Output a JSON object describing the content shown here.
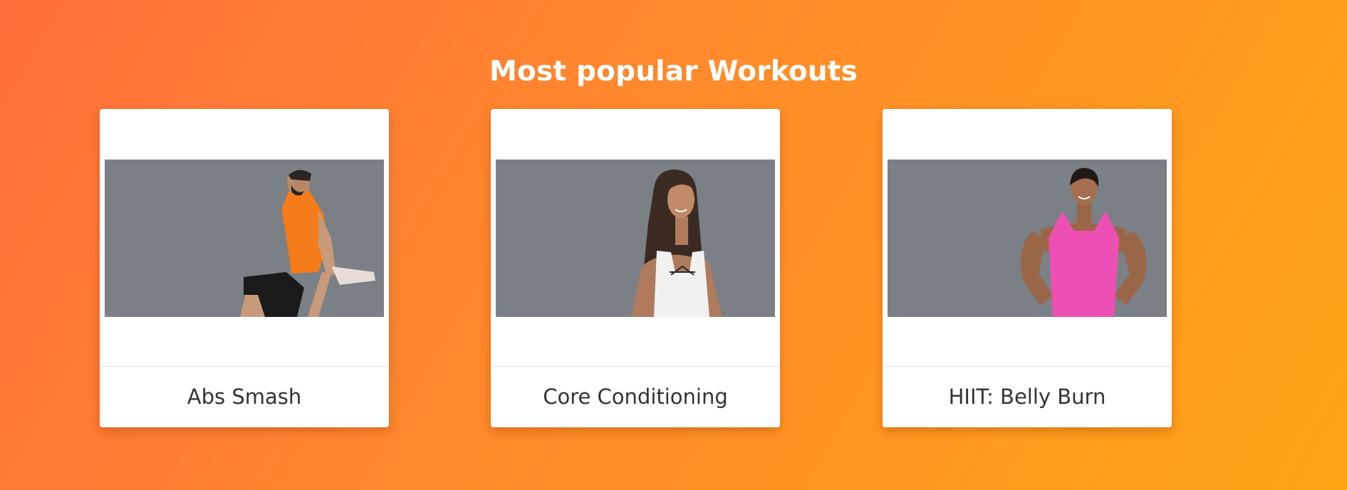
{
  "section": {
    "title": "Most popular Workouts"
  },
  "workouts": [
    {
      "label": "Abs Smash",
      "image": "man-stretching-quad-photo"
    },
    {
      "label": "Core Conditioning",
      "image": "woman-white-top-photo"
    },
    {
      "label": "HIIT: Belly Burn",
      "image": "woman-pink-top-photo"
    }
  ],
  "colors": {
    "background_start": "#ff6f3c",
    "background_end": "#ffa515",
    "photo_backdrop": "#7a8086",
    "card": "#ffffff",
    "label_text": "#333333"
  }
}
